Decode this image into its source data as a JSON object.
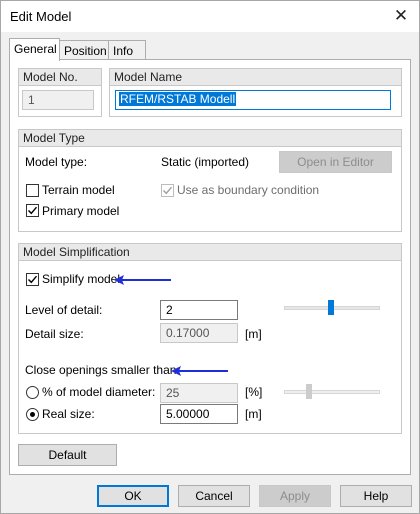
{
  "window": {
    "title": "Edit Model",
    "close_glyph": "✕"
  },
  "tabs": [
    {
      "label": "General",
      "active": true
    },
    {
      "label": "Position",
      "active": false
    },
    {
      "label": "Info",
      "active": false
    }
  ],
  "model_no": {
    "header": "Model No.",
    "value": "1"
  },
  "model_name": {
    "header": "Model Name",
    "value": "RFEM/RSTAB Modell"
  },
  "model_type": {
    "header": "Model Type",
    "type_label": "Model type:",
    "type_value": "Static (imported)",
    "open_editor_label": "Open in Editor",
    "terrain_label": "Terrain model",
    "terrain_checked": false,
    "boundary_label": "Use as boundary condition",
    "boundary_checked": true,
    "primary_label": "Primary model",
    "primary_checked": true
  },
  "simplification": {
    "header": "Model Simplification",
    "simplify_label": "Simplify model",
    "simplify_checked": true,
    "level_label": "Level of detail:",
    "level_value": "2",
    "detail_size_label": "Detail size:",
    "detail_size_value": "0.17000",
    "detail_size_unit": "[m]",
    "close_openings_label": "Close openings smaller than:",
    "percent_label": "% of model diameter:",
    "percent_value": "25",
    "percent_unit": "[%]",
    "realsize_label": "Real size:",
    "realsize_value": "5.00000",
    "realsize_unit": "[m]",
    "selected_option": "Real size"
  },
  "buttons": {
    "default": "Default",
    "ok": "OK",
    "cancel": "Cancel",
    "apply": "Apply",
    "help": "Help"
  },
  "colors": {
    "accent": "#0078d7",
    "annotation_arrow": "#1f2fd8"
  },
  "icons": [
    "close-icon",
    "checkmark-icon",
    "radio-dot-icon",
    "annotation-arrow-icon"
  ]
}
